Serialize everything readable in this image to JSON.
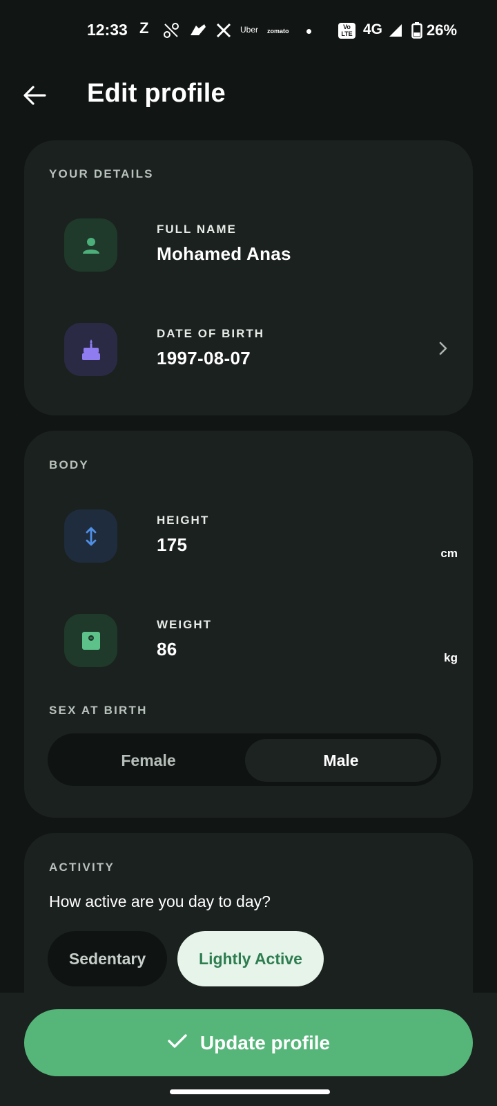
{
  "status_bar": {
    "time": "12:33",
    "apps": [
      "Z",
      "Uber",
      "zomato"
    ],
    "volte": "Vo LTE",
    "network": "4G",
    "battery": "26%"
  },
  "header": {
    "title": "Edit profile"
  },
  "details": {
    "section_title": "YOUR DETAILS",
    "full_name_label": "FULL NAME",
    "full_name_value": "Mohamed Anas",
    "dob_label": "DATE OF BIRTH",
    "dob_value": "1997-08-07"
  },
  "body": {
    "section_title": "BODY",
    "height_label": "HEIGHT",
    "height_value": "175",
    "height_unit": "cm",
    "weight_label": "WEIGHT",
    "weight_value": "86",
    "weight_unit": "kg",
    "sex_title": "SEX AT BIRTH",
    "sex_options": [
      "Female",
      "Male"
    ],
    "sex_selected": "Male"
  },
  "activity": {
    "section_title": "ACTIVITY",
    "question": "How active are you day to day?",
    "options": [
      "Sedentary",
      "Lightly Active"
    ],
    "selected": "Lightly Active"
  },
  "actions": {
    "update_label": "Update profile"
  },
  "colors": {
    "background": "#111513",
    "card": "#1b211e",
    "accent_green": "#56b67a",
    "chip_selected_bg": "#e6f4ea",
    "chip_selected_text": "#2e7d50",
    "icon_person": "#4caf7a",
    "icon_cake": "#8f7cf0",
    "icon_height": "#4f8fe6",
    "icon_weight": "#5cc28a"
  }
}
